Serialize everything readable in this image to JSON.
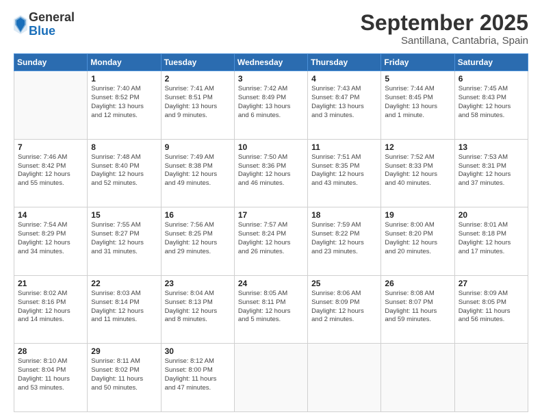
{
  "logo": {
    "general": "General",
    "blue": "Blue"
  },
  "title": "September 2025",
  "subtitle": "Santillana, Cantabria, Spain",
  "weekdays": [
    "Sunday",
    "Monday",
    "Tuesday",
    "Wednesday",
    "Thursday",
    "Friday",
    "Saturday"
  ],
  "weeks": [
    [
      {
        "day": "",
        "info": ""
      },
      {
        "day": "1",
        "info": "Sunrise: 7:40 AM\nSunset: 8:52 PM\nDaylight: 13 hours\nand 12 minutes."
      },
      {
        "day": "2",
        "info": "Sunrise: 7:41 AM\nSunset: 8:51 PM\nDaylight: 13 hours\nand 9 minutes."
      },
      {
        "day": "3",
        "info": "Sunrise: 7:42 AM\nSunset: 8:49 PM\nDaylight: 13 hours\nand 6 minutes."
      },
      {
        "day": "4",
        "info": "Sunrise: 7:43 AM\nSunset: 8:47 PM\nDaylight: 13 hours\nand 3 minutes."
      },
      {
        "day": "5",
        "info": "Sunrise: 7:44 AM\nSunset: 8:45 PM\nDaylight: 13 hours\nand 1 minute."
      },
      {
        "day": "6",
        "info": "Sunrise: 7:45 AM\nSunset: 8:43 PM\nDaylight: 12 hours\nand 58 minutes."
      }
    ],
    [
      {
        "day": "7",
        "info": "Sunrise: 7:46 AM\nSunset: 8:42 PM\nDaylight: 12 hours\nand 55 minutes."
      },
      {
        "day": "8",
        "info": "Sunrise: 7:48 AM\nSunset: 8:40 PM\nDaylight: 12 hours\nand 52 minutes."
      },
      {
        "day": "9",
        "info": "Sunrise: 7:49 AM\nSunset: 8:38 PM\nDaylight: 12 hours\nand 49 minutes."
      },
      {
        "day": "10",
        "info": "Sunrise: 7:50 AM\nSunset: 8:36 PM\nDaylight: 12 hours\nand 46 minutes."
      },
      {
        "day": "11",
        "info": "Sunrise: 7:51 AM\nSunset: 8:35 PM\nDaylight: 12 hours\nand 43 minutes."
      },
      {
        "day": "12",
        "info": "Sunrise: 7:52 AM\nSunset: 8:33 PM\nDaylight: 12 hours\nand 40 minutes."
      },
      {
        "day": "13",
        "info": "Sunrise: 7:53 AM\nSunset: 8:31 PM\nDaylight: 12 hours\nand 37 minutes."
      }
    ],
    [
      {
        "day": "14",
        "info": "Sunrise: 7:54 AM\nSunset: 8:29 PM\nDaylight: 12 hours\nand 34 minutes."
      },
      {
        "day": "15",
        "info": "Sunrise: 7:55 AM\nSunset: 8:27 PM\nDaylight: 12 hours\nand 31 minutes."
      },
      {
        "day": "16",
        "info": "Sunrise: 7:56 AM\nSunset: 8:25 PM\nDaylight: 12 hours\nand 29 minutes."
      },
      {
        "day": "17",
        "info": "Sunrise: 7:57 AM\nSunset: 8:24 PM\nDaylight: 12 hours\nand 26 minutes."
      },
      {
        "day": "18",
        "info": "Sunrise: 7:59 AM\nSunset: 8:22 PM\nDaylight: 12 hours\nand 23 minutes."
      },
      {
        "day": "19",
        "info": "Sunrise: 8:00 AM\nSunset: 8:20 PM\nDaylight: 12 hours\nand 20 minutes."
      },
      {
        "day": "20",
        "info": "Sunrise: 8:01 AM\nSunset: 8:18 PM\nDaylight: 12 hours\nand 17 minutes."
      }
    ],
    [
      {
        "day": "21",
        "info": "Sunrise: 8:02 AM\nSunset: 8:16 PM\nDaylight: 12 hours\nand 14 minutes."
      },
      {
        "day": "22",
        "info": "Sunrise: 8:03 AM\nSunset: 8:14 PM\nDaylight: 12 hours\nand 11 minutes."
      },
      {
        "day": "23",
        "info": "Sunrise: 8:04 AM\nSunset: 8:13 PM\nDaylight: 12 hours\nand 8 minutes."
      },
      {
        "day": "24",
        "info": "Sunrise: 8:05 AM\nSunset: 8:11 PM\nDaylight: 12 hours\nand 5 minutes."
      },
      {
        "day": "25",
        "info": "Sunrise: 8:06 AM\nSunset: 8:09 PM\nDaylight: 12 hours\nand 2 minutes."
      },
      {
        "day": "26",
        "info": "Sunrise: 8:08 AM\nSunset: 8:07 PM\nDaylight: 11 hours\nand 59 minutes."
      },
      {
        "day": "27",
        "info": "Sunrise: 8:09 AM\nSunset: 8:05 PM\nDaylight: 11 hours\nand 56 minutes."
      }
    ],
    [
      {
        "day": "28",
        "info": "Sunrise: 8:10 AM\nSunset: 8:04 PM\nDaylight: 11 hours\nand 53 minutes."
      },
      {
        "day": "29",
        "info": "Sunrise: 8:11 AM\nSunset: 8:02 PM\nDaylight: 11 hours\nand 50 minutes."
      },
      {
        "day": "30",
        "info": "Sunrise: 8:12 AM\nSunset: 8:00 PM\nDaylight: 11 hours\nand 47 minutes."
      },
      {
        "day": "",
        "info": ""
      },
      {
        "day": "",
        "info": ""
      },
      {
        "day": "",
        "info": ""
      },
      {
        "day": "",
        "info": ""
      }
    ]
  ]
}
